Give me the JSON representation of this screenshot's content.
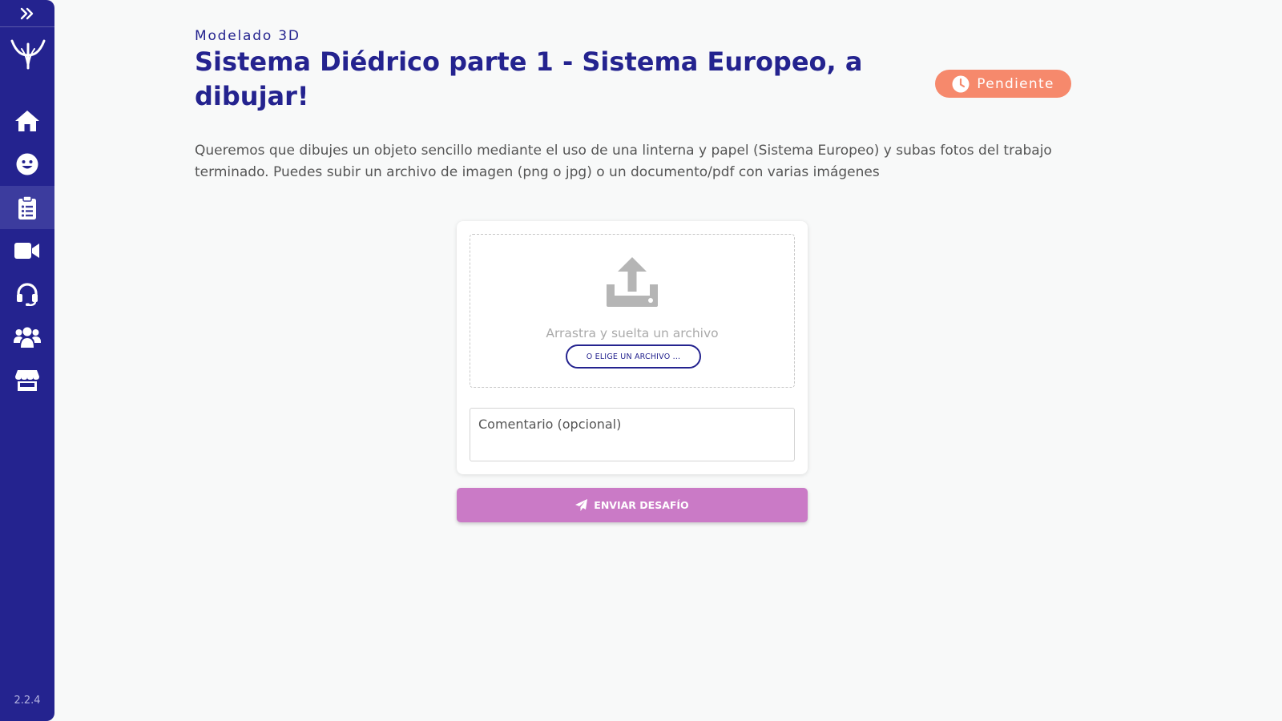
{
  "sidebar": {
    "expand_icon": "double-chevron-right-icon",
    "logo_icon": "brand-logo",
    "items": [
      {
        "icon": "home-icon",
        "active": false
      },
      {
        "icon": "smiley-icon",
        "active": false
      },
      {
        "icon": "clipboard-list-icon",
        "active": true
      },
      {
        "icon": "video-camera-icon",
        "active": false
      },
      {
        "icon": "headset-icon",
        "active": false
      },
      {
        "icon": "users-icon",
        "active": false
      },
      {
        "icon": "store-icon",
        "active": false
      }
    ],
    "version": "2.2.4"
  },
  "challenge": {
    "category": "Modelado 3D",
    "title": "Sistema Diédrico parte 1 - Sistema Europeo, a dibujar!",
    "status": "Pendiente",
    "status_icon": "clock-icon",
    "description": "Queremos que dibujes un objeto sencillo mediante el uso de una linterna y papel (Sistema Europeo) y subas fotos del trabajo terminado. Puedes subir un archivo de imagen (png o jpg) o un documento/pdf con varias imágenes"
  },
  "upload": {
    "icon": "upload-icon",
    "drop_text": "Arrastra y suelta un archivo",
    "choose_label": "O ELIGE UN ARCHIVO ..."
  },
  "comment": {
    "placeholder": "Comentario (opcional)",
    "value": ""
  },
  "submit": {
    "icon": "paper-plane-icon",
    "label": "ENVIAR DESAFÍO"
  },
  "colors": {
    "sidebar_bg": "#24238f",
    "sidebar_active": "#3c3c9e",
    "title": "#24238f",
    "status_badge": "#f6896c",
    "submit_button": "#ca7ac6",
    "page_bg": "#f8f9f9"
  }
}
